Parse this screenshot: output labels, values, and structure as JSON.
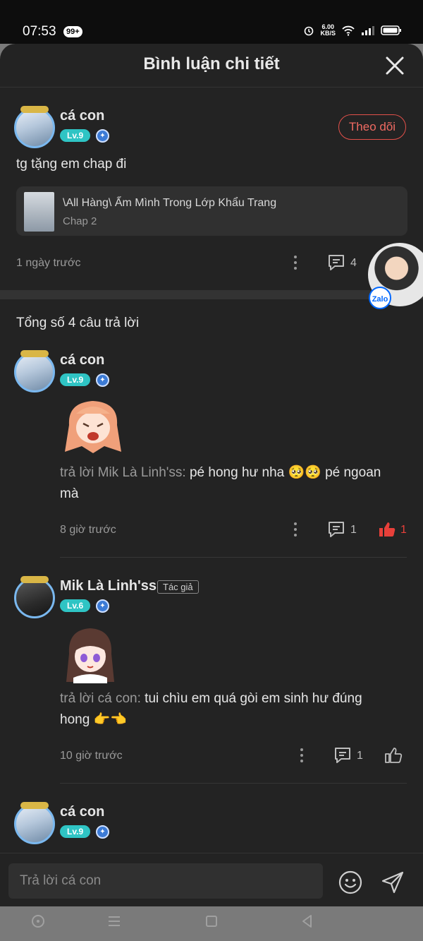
{
  "status": {
    "time": "07:53",
    "notifications": "99+",
    "net_speed_value": "6.00",
    "net_speed_unit": "KB/S"
  },
  "header": {
    "title": "Bình luận chi tiết"
  },
  "main_comment": {
    "name": "cá con",
    "level": "Lv.9",
    "follow_label": "Theo dõi",
    "text": "tg tặng em chap đi",
    "chapter_card": {
      "title": "\\All Hàng\\ Ẩm Mình Trong Lớp Khẩu Trang",
      "chapter": "Chap 2"
    },
    "time": "1 ngày trước",
    "reply_count": "4"
  },
  "floating_bubble": {
    "badge": "Zalo"
  },
  "total_replies": "Tổng số 4 câu trả lời",
  "replies": [
    {
      "name": "cá con",
      "level": "Lv.9",
      "reply_prefix": "trả lời Mik Là Linh'ss: ",
      "text_line1": "pé hong hư nha 🥺🥺 pé ngoan",
      "text_line2": "mà",
      "time": "8 giờ trước",
      "reply_count": "1",
      "like_count": "1"
    },
    {
      "name": "Mik Là Linh'ss",
      "tag": "Tác giả",
      "level": "Lv.6",
      "reply_prefix": "trả lời cá con: ",
      "text_line1": "tui chìu em quá gòi em sinh hư đúng",
      "text_line2": "hong 👉👈",
      "time": "10 giờ trước",
      "reply_count": "1"
    },
    {
      "name": "cá con",
      "level": "Lv.9"
    }
  ],
  "input": {
    "placeholder": "Trả lời cá con"
  },
  "colors": {
    "background": "#232323",
    "accent_red": "#e2504a",
    "level_badge": "#2fc4c4",
    "like_active": "#e8403a"
  }
}
